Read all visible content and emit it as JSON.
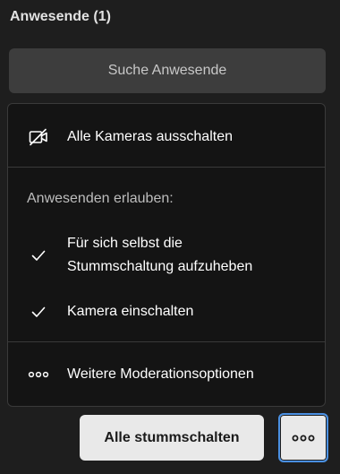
{
  "header": {
    "title": "Anwesende (1)"
  },
  "search": {
    "label": "Suche Anwesende"
  },
  "menu": {
    "items": [
      {
        "label": "Alle Kameras ausschalten",
        "icon": "camera-off-icon"
      }
    ],
    "section_label": "Anwesenden erlauben:",
    "allow_items": [
      {
        "label_line1": "Für sich selbst die",
        "label_line2": "Stummschaltung aufzuheben",
        "icon": "checkmark-icon",
        "checked": true
      },
      {
        "label": "Kamera einschalten",
        "icon": "checkmark-icon",
        "checked": true
      }
    ],
    "more_item": {
      "label": "Weitere Moderationsoptionen",
      "icon": "more-dots-icon"
    }
  },
  "footer": {
    "mute_all_label": "Alle stummschalten",
    "more_icon": "more-dots-icon"
  },
  "colors": {
    "focus": "#4a90e2",
    "background": "#1e1e1e",
    "menu_bg": "#141414"
  }
}
